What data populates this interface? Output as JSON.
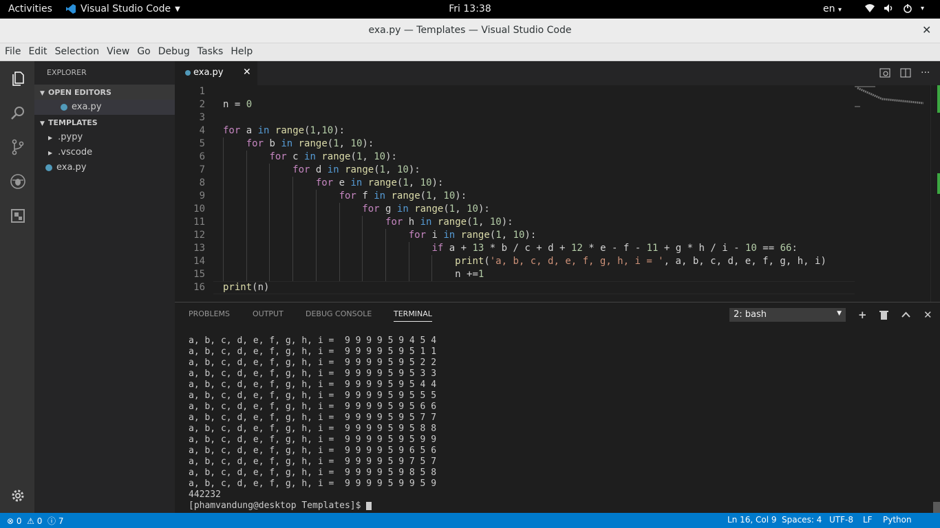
{
  "os_bar": {
    "activities": "Activities",
    "app_name": "Visual Studio Code",
    "clock": "Fri 13:38",
    "lang": "en"
  },
  "window": {
    "title": "exa.py — Templates — Visual Studio Code"
  },
  "menu": [
    "File",
    "Edit",
    "Selection",
    "View",
    "Go",
    "Debug",
    "Tasks",
    "Help"
  ],
  "activity_icons": [
    "files-icon",
    "search-icon",
    "source-control-icon",
    "debug-icon",
    "extensions-icon"
  ],
  "sidebar": {
    "header": "EXPLORER",
    "open_editors": "OPEN EDITORS",
    "open_file": "exa.py",
    "folder": "TEMPLATES",
    "items": [
      ".pypy",
      ".vscode",
      "exa.py"
    ]
  },
  "tab": {
    "label": "exa.py"
  },
  "editor": {
    "lines": [
      "",
      "n = 0",
      "",
      "for a in range(1,10):",
      "    for b in range(1, 10):",
      "        for c in range(1, 10):",
      "            for d in range(1, 10):",
      "                for e in range(1, 10):",
      "                    for f in range(1, 10):",
      "                        for g in range(1, 10):",
      "                            for h in range(1, 10):",
      "                                for i in range(1, 10):",
      "                                    if a + 13 * b / c + d + 12 * e - f - 11 + g * h / i - 10 == 66:",
      "                                        print('a, b, c, d, e, f, g, h, i = ', a, b, c, d, e, f, g, h, i)",
      "                                        n +=1",
      "print(n)"
    ]
  },
  "panel": {
    "tabs": [
      "PROBLEMS",
      "OUTPUT",
      "DEBUG CONSOLE",
      "TERMINAL"
    ],
    "active_tab": "TERMINAL",
    "terminal_select": "2: bash",
    "output_lines": [
      "a, b, c, d, e, f, g, h, i =  9 9 9 9 5 9 4 5 4",
      "a, b, c, d, e, f, g, h, i =  9 9 9 9 5 9 5 1 1",
      "a, b, c, d, e, f, g, h, i =  9 9 9 9 5 9 5 2 2",
      "a, b, c, d, e, f, g, h, i =  9 9 9 9 5 9 5 3 3",
      "a, b, c, d, e, f, g, h, i =  9 9 9 9 5 9 5 4 4",
      "a, b, c, d, e, f, g, h, i =  9 9 9 9 5 9 5 5 5",
      "a, b, c, d, e, f, g, h, i =  9 9 9 9 5 9 5 6 6",
      "a, b, c, d, e, f, g, h, i =  9 9 9 9 5 9 5 7 7",
      "a, b, c, d, e, f, g, h, i =  9 9 9 9 5 9 5 8 8",
      "a, b, c, d, e, f, g, h, i =  9 9 9 9 5 9 5 9 9",
      "a, b, c, d, e, f, g, h, i =  9 9 9 9 5 9 6 5 6",
      "a, b, c, d, e, f, g, h, i =  9 9 9 9 5 9 7 5 7",
      "a, b, c, d, e, f, g, h, i =  9 9 9 9 5 9 8 5 8",
      "a, b, c, d, e, f, g, h, i =  9 9 9 9 5 9 9 5 9",
      "442232"
    ],
    "prompt": "[phamvandung@desktop Templates]$ "
  },
  "status": {
    "errors": "0",
    "warnings": "0",
    "infos": "7",
    "position": "Ln 16, Col 9",
    "spaces": "Spaces: 4",
    "encoding": "UTF-8",
    "eol": "LF",
    "language": "Python"
  }
}
